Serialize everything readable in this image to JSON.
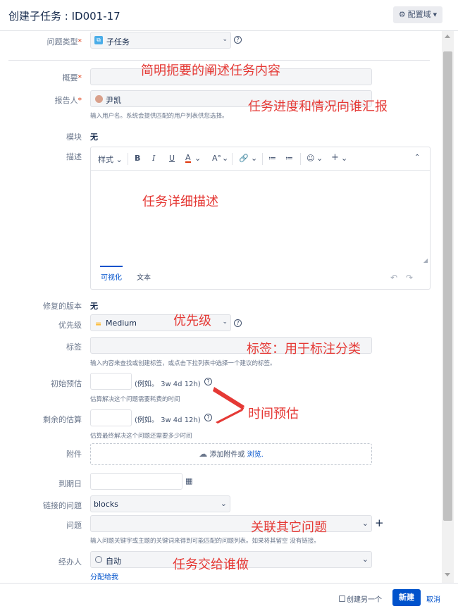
{
  "header": {
    "title": "创建子任务 : ID001-17",
    "config_label": "配置域"
  },
  "fields": {
    "issue_type": {
      "label": "问题类型",
      "value": "子任务"
    },
    "summary": {
      "label": "概要"
    },
    "reporter": {
      "label": "报告人",
      "value": "尹凯",
      "help": "输入用户名。系统会提供匹配的用户列表供您选择。"
    },
    "module": {
      "label": "模块",
      "value": "无"
    },
    "description": {
      "label": "描述"
    },
    "fix_version": {
      "label": "修复的版本",
      "value": "无"
    },
    "priority": {
      "label": "优先级",
      "value": "Medium"
    },
    "labels": {
      "label": "标签",
      "help": "输入内容来查找或创建标签，或点击下拉列表中选择一个建议的标签。"
    },
    "original_estimate": {
      "label": "初始预估",
      "example": "(例如。 3w 4d 12h)",
      "help": "估算解决这个问题需要耗费的时间"
    },
    "remaining_estimate": {
      "label": "剩余的估算",
      "example": "(例如。 3w 4d 12h)",
      "help": "估算最终解决这个问题还需要多少时间"
    },
    "attachment": {
      "label": "附件",
      "text": "添加附件或",
      "browse": "浏览."
    },
    "due_date": {
      "label": "到期日"
    },
    "link_type": {
      "label": "链接的问题",
      "value": "blocks"
    },
    "issue": {
      "label": "问题",
      "help": "输入问题关键字或主题的关键词来得到可能匹配的问题列表。如果将其留空  没有链接。"
    },
    "assignee": {
      "label": "经办人",
      "value": "自动",
      "assign_to_me": "分配给我"
    }
  },
  "editor": {
    "toolbar": {
      "style": "样式",
      "bold": "B",
      "italic": "I",
      "underline": "U",
      "color": "A",
      "more_format": "A°",
      "link": "🔗",
      "bullet": "≔",
      "numbered": "≔",
      "emoji": "☺",
      "insert": "+"
    },
    "tabs": [
      "可视化",
      "文本"
    ]
  },
  "annotations": {
    "summary": "简明扼要的阐述任务内容",
    "reporter": "任务进度和情况向谁汇报",
    "description": "任务详细描述",
    "priority": "优先级",
    "labels": "标签：用于标注分类",
    "estimate": "时间预估",
    "issue": "关联其它问题",
    "assignee": "任务交给谁做"
  },
  "footer": {
    "create_another": "创建另一个",
    "create": "新建",
    "cancel": "取消"
  },
  "colors": {
    "accent": "#0052cc",
    "annotation": "#e53935",
    "required": "#de350b"
  }
}
